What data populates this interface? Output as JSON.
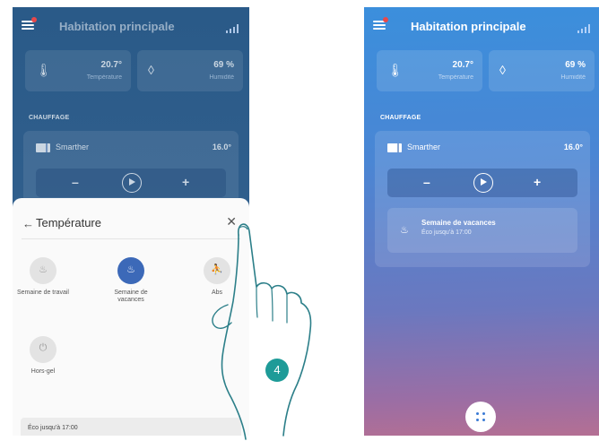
{
  "app": {
    "title": "Habitation principale"
  },
  "sensors": {
    "temperature": {
      "value": "20.7°",
      "label": "Température"
    },
    "humidity": {
      "value": "69 %",
      "label": "Humidité"
    }
  },
  "heating": {
    "section_label": "CHAUFFAGE",
    "device_name": "Smarther",
    "setpoint": "16.0°",
    "minus_label": "–",
    "plus_label": "+",
    "mode_name": "Semaine de vacances",
    "mode_detail": "Éco jusqu’à 17:00"
  },
  "sheet": {
    "back_glyph": "←",
    "title": "Température",
    "close_glyph": "✕",
    "options": [
      {
        "label": "Semaine de travail",
        "icon": "flame-icon"
      },
      {
        "label": "Semaine de vacances",
        "icon": "flame-icon"
      },
      {
        "label": "Abs",
        "icon": "walking-person-icon"
      },
      {
        "label": "Hors-gel",
        "icon": "power-icon"
      }
    ],
    "status": "Éco jusqu’à 17:00"
  },
  "step": {
    "number": "4"
  },
  "colors": {
    "accent": "#3c69b8",
    "step_badge": "#1e9b98",
    "notification": "#e8484a"
  }
}
